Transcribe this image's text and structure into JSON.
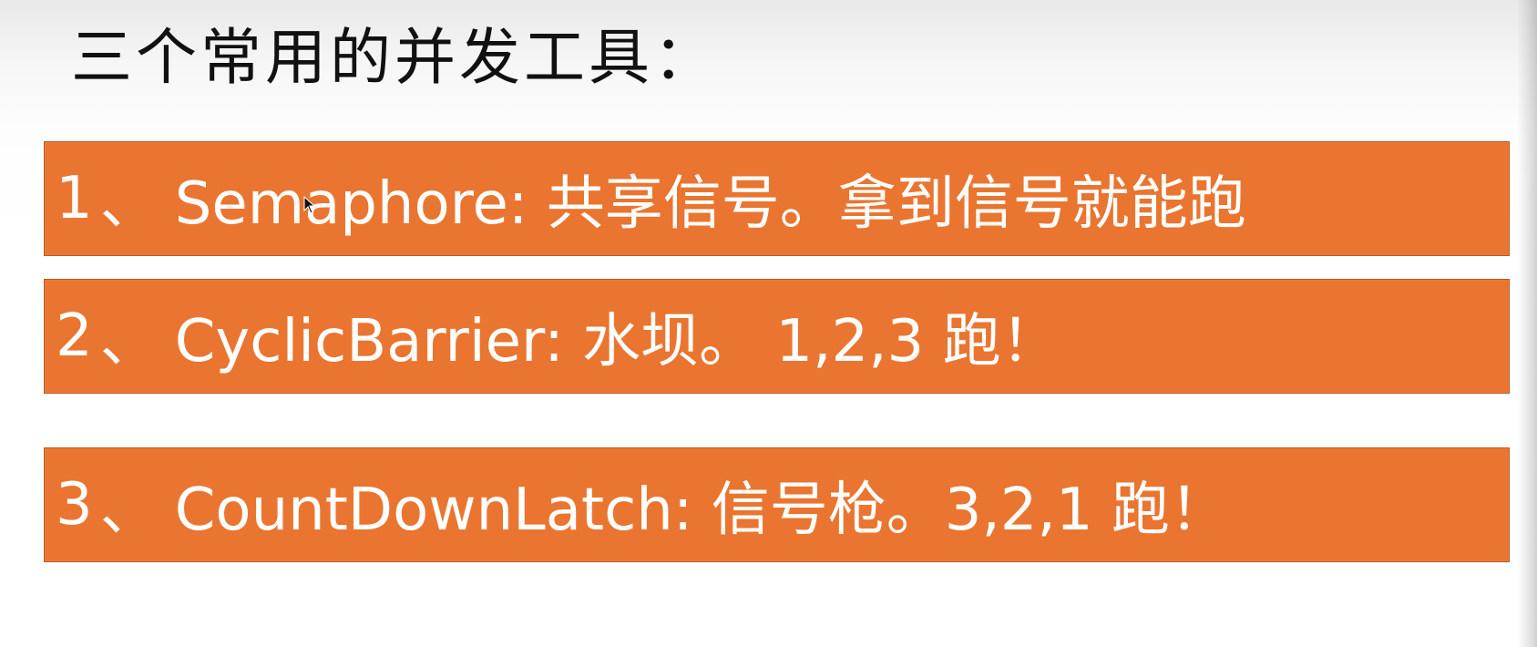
{
  "slide": {
    "title": "三个常用的并发工具："
  },
  "items": [
    {
      "number": "1",
      "separator": "、",
      "text": "Semaphore: 共享信号。拿到信号就能跑"
    },
    {
      "number": "2",
      "separator": "、",
      "text": "CyclicBarrier: 水坝。 1,2,3 跑！"
    },
    {
      "number": "3",
      "separator": "、",
      "text": "CountDownLatch: 信号枪。3,2,1 跑！"
    }
  ],
  "colors": {
    "item_background": "#ea7530",
    "item_text": "#ffffff",
    "title_text": "#111111"
  }
}
